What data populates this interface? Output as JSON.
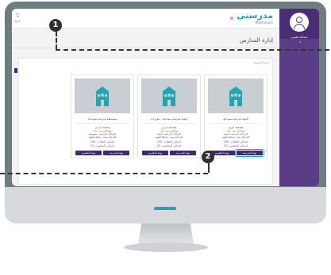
{
  "header": {
    "logo_text": "مدرستي",
    "logo_sub": "Madrasati",
    "exit_icon": "⎋",
    "exit_label": "خروج"
  },
  "sidebar": {
    "user_name": "عبدالله العتيبي",
    "caret": "▾"
  },
  "page": {
    "title": "إدارة المدارس",
    "breadcrumb": "اسم المدرسة"
  },
  "schools": [
    {
      "title": "ثانوية مدرسة نموذجية",
      "id_line": "الرقم: ####",
      "type_line": "نوع المدرسة: بنات",
      "stages_line": "المراحل الدراسية: ثانوية",
      "principal_line": "قائد المدرسة: عبدالله الفهيد",
      "students": "إجمالي الطلاب: 100",
      "teachers": "إجمالي المعلمين: 20",
      "btn_school": "تهيئة المدرسة",
      "btn_teachers": "تهيئة المعلمين"
    },
    {
      "title": "ثانوية مدرسة نموذجية - مقررات",
      "id_line": "الرقم: ####",
      "type_line": "نوع المدرسة: بنات",
      "stages_line": "المراحل الدراسية: ثانوية",
      "principal_line": "قائد المدرسة: عبدالله الفهيد",
      "students": "إجمالي الطلاب: 100",
      "teachers": "إجمالي المعلمين: 20",
      "btn_school": "تهيئة المدرسة",
      "btn_teachers": "تهيئة المعلمين"
    },
    {
      "title": "متوسطة مدرسة نموذجية",
      "id_line": "الرقم: ####",
      "type_line": "نوع المدرسة: بنات",
      "stages_line": "المراحل الدراسية: متوسطة",
      "principal_line": "قائد المدرسة: عبدالله الفهيد",
      "students": "إجمالي الطلاب: 100",
      "teachers": "إجمالي المعلمين: 20",
      "btn_school": "تهيئة المدرسة",
      "btn_teachers": "تهيئة المعلمين"
    }
  ],
  "annotations": {
    "marker_1": "1",
    "marker_2": "2"
  },
  "colors": {
    "sidebar": "#5b3c86",
    "accent": "#1aa9b4",
    "button": "#3d2b6e"
  }
}
